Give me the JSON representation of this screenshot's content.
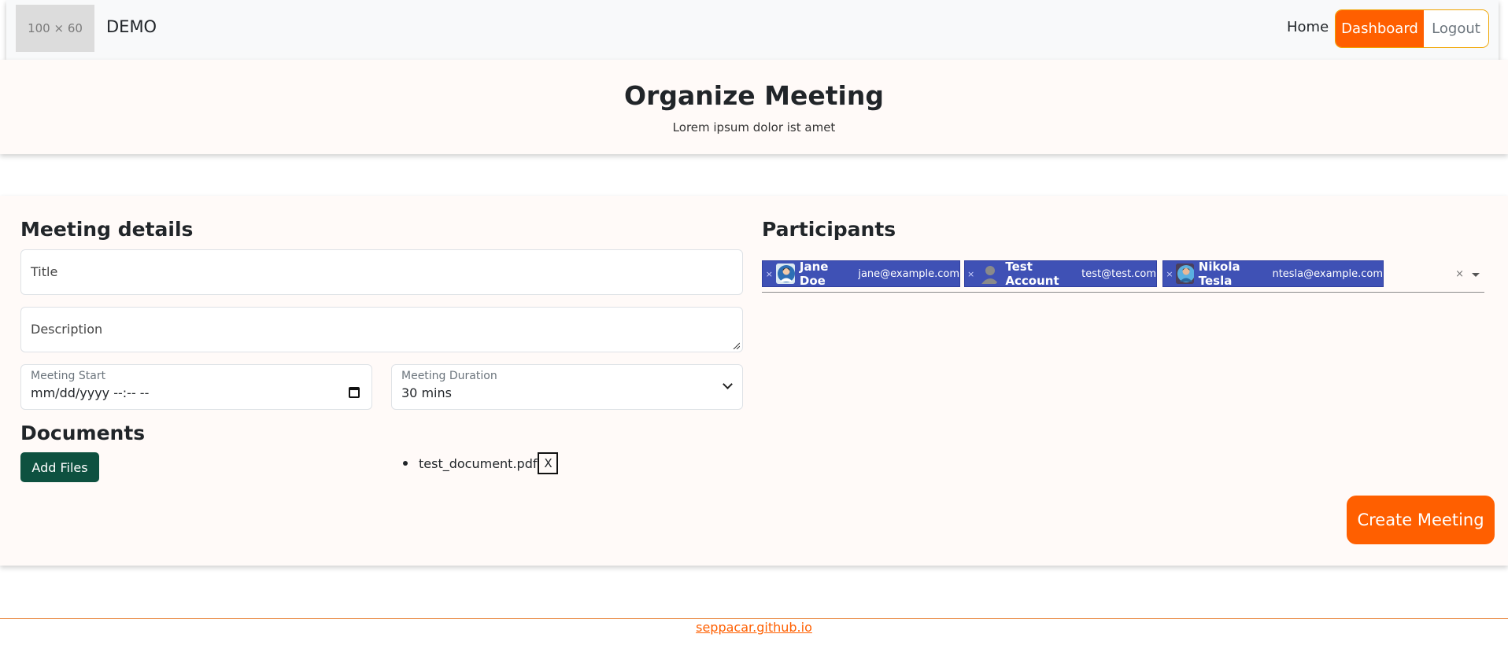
{
  "navbar": {
    "logo_placeholder": "100 × 60",
    "brand": "DEMO",
    "home_label": "Home",
    "dashboard_label": "Dashboard",
    "logout_label": "Logout"
  },
  "hero": {
    "title": "Organize Meeting",
    "subtitle": "Lorem ipsum dolor ist amet"
  },
  "meeting_details": {
    "heading": "Meeting details",
    "title_placeholder": "Title",
    "description_placeholder": "Description",
    "start_label": "Meeting Start",
    "start_value": "mm/dd/yyyy --:-- --",
    "duration_label": "Meeting Duration",
    "duration_value": "30 mins"
  },
  "documents": {
    "heading": "Documents",
    "add_files_label": "Add Files",
    "files": [
      {
        "name": "test_document.pdf",
        "remove_label": "X"
      }
    ]
  },
  "participants": {
    "heading": "Participants",
    "remove_symbol": "×",
    "clear_symbol": "×",
    "items": [
      {
        "name": "Jane Doe",
        "email": "jane@example.com",
        "avatar": "person-avatar-icon"
      },
      {
        "name": "Test Account",
        "email": "test@test.com",
        "avatar": "default-user-icon"
      },
      {
        "name": "Nikola Tesla",
        "email": "ntesla@example.com",
        "avatar": "person-avatar-icon"
      }
    ]
  },
  "actions": {
    "create_label": "Create Meeting"
  },
  "footer": {
    "link": "seppacar.github.io"
  },
  "colors": {
    "accent_orange": "#ff5f00",
    "tag_blue": "#3f51b5",
    "add_files_green": "#0e5140",
    "section_bg": "#fffaf8"
  }
}
